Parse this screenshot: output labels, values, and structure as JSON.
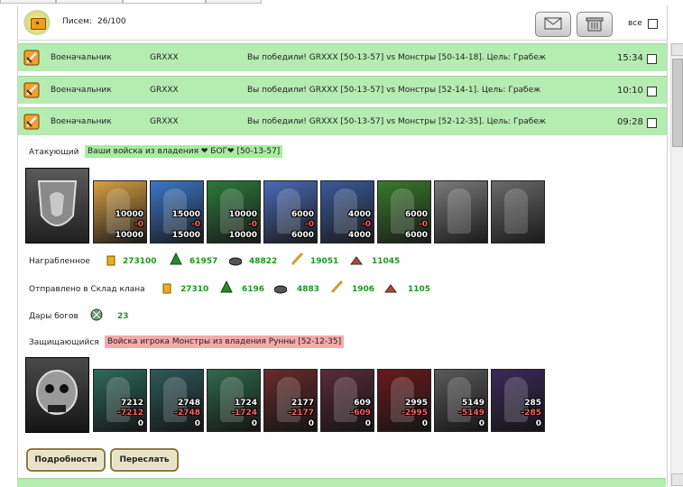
{
  "header": {
    "letters_label": "Писем:",
    "letters_count": "26/100",
    "all_label": "все"
  },
  "messages": [
    {
      "from": "Военачальник",
      "player": "GRXXX",
      "subject": "Вы победили! GRXXX [50-13-57] vs Монстры [50-14-18]. Цель: Грабеж",
      "time": "15:34"
    },
    {
      "from": "Военачальник",
      "player": "GRXXX",
      "subject": "Вы победили! GRXXX [50-13-57] vs Монстры [52-14-1]. Цель: Грабеж",
      "time": "10:10"
    },
    {
      "from": "Военачальник",
      "player": "GRXXX",
      "subject": "Вы победили! GRXXX [50-13-57] vs Монстры [52-12-35]. Цель: Грабеж",
      "time": "09:28"
    }
  ],
  "detail": {
    "attacker_label": "Атакующий",
    "attacker_tag": "Ваши войска из владения ❤ БОГ❤ [50-13-57]",
    "attacker_units": [
      {
        "initial": "10000",
        "lost": "-0",
        "remain": "10000",
        "color": "#d8a040"
      },
      {
        "initial": "15000",
        "lost": "-0",
        "remain": "15000",
        "color": "#3a78c8"
      },
      {
        "initial": "10000",
        "lost": "-0",
        "remain": "10000",
        "color": "#2a7a3a"
      },
      {
        "initial": "6000",
        "lost": "-0",
        "remain": "6000",
        "color": "#4a6ab8"
      },
      {
        "initial": "4000",
        "lost": "-0",
        "remain": "4000",
        "color": "#3a5a9a"
      },
      {
        "initial": "6000",
        "lost": "-0",
        "remain": "6000",
        "color": "#3a7a2a"
      },
      {
        "initial": "",
        "lost": "",
        "remain": "",
        "color": "#7a7a7a"
      },
      {
        "initial": "",
        "lost": "",
        "remain": "",
        "color": "#6a6a6a"
      }
    ],
    "loot_label": "Награбленное",
    "loot": [
      "273100",
      "61957",
      "48822",
      "19051",
      "11045"
    ],
    "clan_label": "Отправлено в Склад клана",
    "clan": [
      "27310",
      "6196",
      "4883",
      "1906",
      "1105"
    ],
    "gifts_label": "Дары богов",
    "gifts": "23",
    "defender_label": "Защищающийся",
    "defender_tag": "Войска игрока Монстры из владения Рунны [52-12-35]",
    "defender_units": [
      {
        "initial": "7212",
        "lost": "-7212",
        "remain": "0"
      },
      {
        "initial": "2748",
        "lost": "-2748",
        "remain": "0"
      },
      {
        "initial": "1724",
        "lost": "-1724",
        "remain": "0"
      },
      {
        "initial": "2177",
        "lost": "-2177",
        "remain": "0"
      },
      {
        "initial": "609",
        "lost": "-609",
        "remain": "0"
      },
      {
        "initial": "2995",
        "lost": "-2995",
        "remain": "0"
      },
      {
        "initial": "5149",
        "lost": "-5149",
        "remain": "0"
      },
      {
        "initial": "285",
        "lost": "-285",
        "remain": "0"
      }
    ],
    "details_button": "Подробности",
    "forward_button": "Переслать"
  }
}
